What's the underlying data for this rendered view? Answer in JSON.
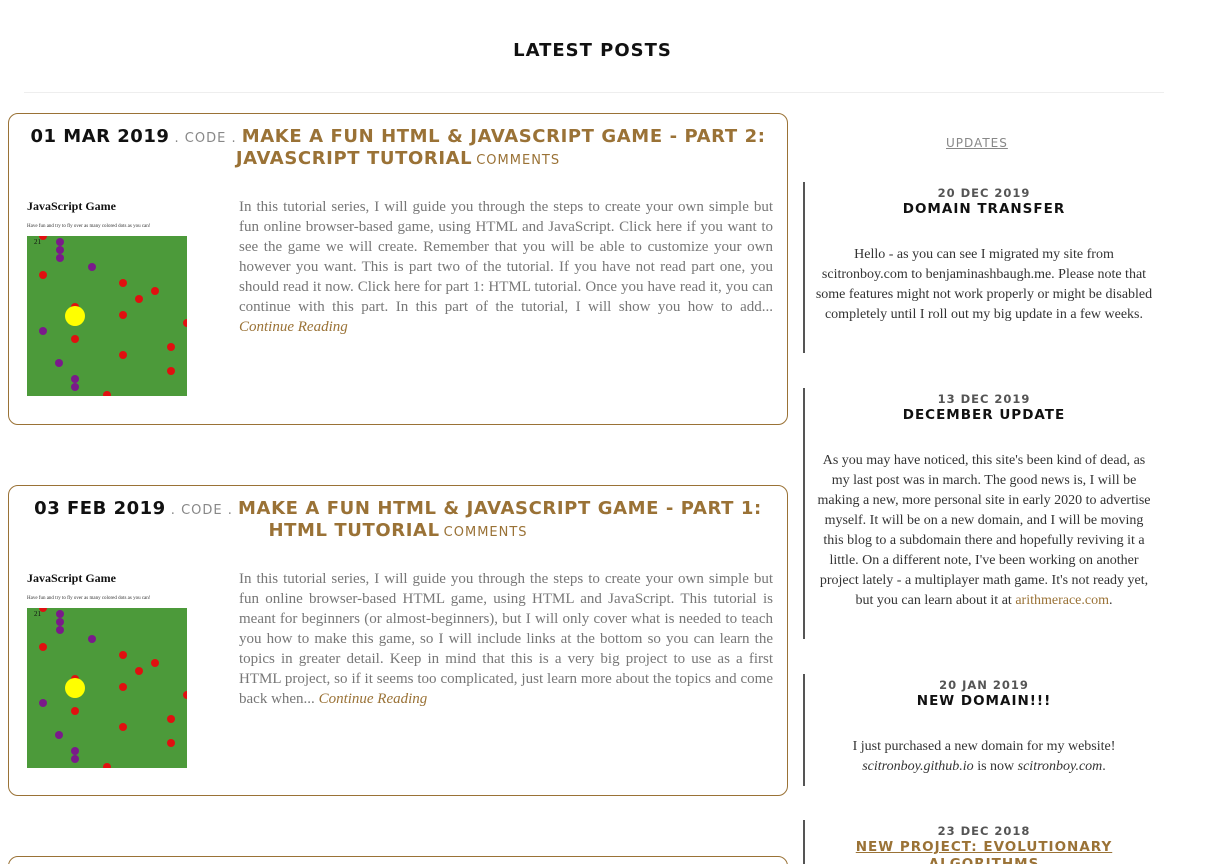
{
  "page": {
    "title": "LATEST POSTS"
  },
  "posts": [
    {
      "date": "01 MAR 2019",
      "sep1": " . ",
      "category": "CODE",
      "sep2": " . ",
      "title": "MAKE A FUN HTML & JAVASCRIPT GAME - PART 2: JAVASCRIPT TUTORIAL",
      "comments": "COMMENTS",
      "thumb": {
        "title": "JavaScript Game",
        "subtitle": "Have fun and try to fly over as many colored dots as you can!",
        "score": "21"
      },
      "excerpt": "In this tutorial series, I will guide you through the steps to create your own simple but fun online browser-based game, using HTML and JavaScript. Click here if you want to see the game we will create. Remember that you will be able to customize your own however you want. This is part two of the tutorial. If you have not read part one, you should read it now. Click here for part 1: HTML tutorial. Once you have read it, you can continue with this part. In this part of the tutorial, I will show you how to add...",
      "continue": "Continue Reading"
    },
    {
      "date": "03 FEB 2019",
      "sep1": " . ",
      "category": "CODE",
      "sep2": " . ",
      "title": "MAKE A FUN HTML & JAVASCRIPT GAME - PART 1: HTML TUTORIAL",
      "comments": "COMMENTS",
      "thumb": {
        "title": "JavaScript Game",
        "subtitle": "Have fun and try to fly over as many colored dots as you can!",
        "score": "21"
      },
      "excerpt": "In this tutorial series, I will guide you through the steps to create your own simple but fun online browser-based HTML game, using HTML and JavaScript. This tutorial is meant for beginners (or almost-beginners), but I will only cover what is needed to teach you how to make this game, so I will include links at the bottom so you can learn the topics in greater detail. Keep in mind that this is a very big project to use as a first HTML project, so if it seems too complicated, just learn more about the topics and come back when...",
      "continue": "Continue Reading"
    }
  ],
  "sidebar": {
    "tab": "UPDATES",
    "updates": [
      {
        "date": "20 DEC 2019",
        "title": "DOMAIN TRANSFER",
        "body": "Hello - as you can see I migrated my site from scitronboy.com to benjaminashbaugh.me. Please note that some features might not work properly or might be disabled completely until I roll out my big update in a few weeks."
      },
      {
        "date": "13 DEC 2019",
        "title": "DECEMBER UPDATE",
        "body": "As you may have noticed, this site's been kind of dead, as my last post was in march. The good news is, I will be making a new, more personal site in early 2020 to advertise myself. It will be on a new domain, and I will be moving this blog to a subdomain there and hopefully reviving it a little. On a different note, I've been working on another project lately - a multiplayer math game. It's not ready yet, but you can learn about it at",
        "link": "arithmerace.com",
        "tail": "."
      },
      {
        "date": "20 JAN 2019",
        "title": "NEW DOMAIN!!!",
        "body": "I just purchased a new domain for my website!",
        "old_domain": "scitronboy.github.io",
        "mid": " is now ",
        "new_domain": "scitronboy.com",
        "tail": "."
      },
      {
        "date": "23 DEC 2018",
        "title": "NEW PROJECT: EVOLUTIONARY ALGORITHMS"
      }
    ]
  },
  "colors": {
    "accent": "#9a7236",
    "grass": "#4c9a3a",
    "dot_red": "#e01010",
    "dot_purple": "#7a1a8a",
    "player": "#ffff00"
  }
}
